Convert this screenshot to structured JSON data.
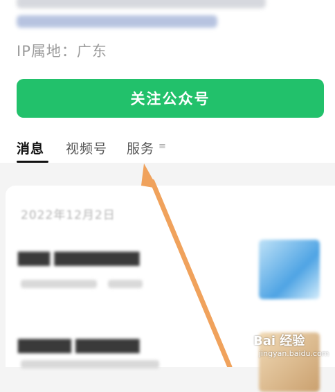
{
  "header": {
    "ip_location": "IP属地：广东",
    "follow_button": "关注公众号"
  },
  "tabs": [
    {
      "label": "消息",
      "active": true
    },
    {
      "label": "视频号",
      "active": false
    },
    {
      "label": "服务",
      "active": false
    }
  ],
  "tab_more_glyph": "≡",
  "feed": {
    "date": "2022年12月2日"
  },
  "watermark": {
    "main": "Bai 经验",
    "sub": "jingyan.baidu.com"
  },
  "colors": {
    "accent_green": "#22c16b",
    "arrow_orange": "#f0a25c"
  }
}
